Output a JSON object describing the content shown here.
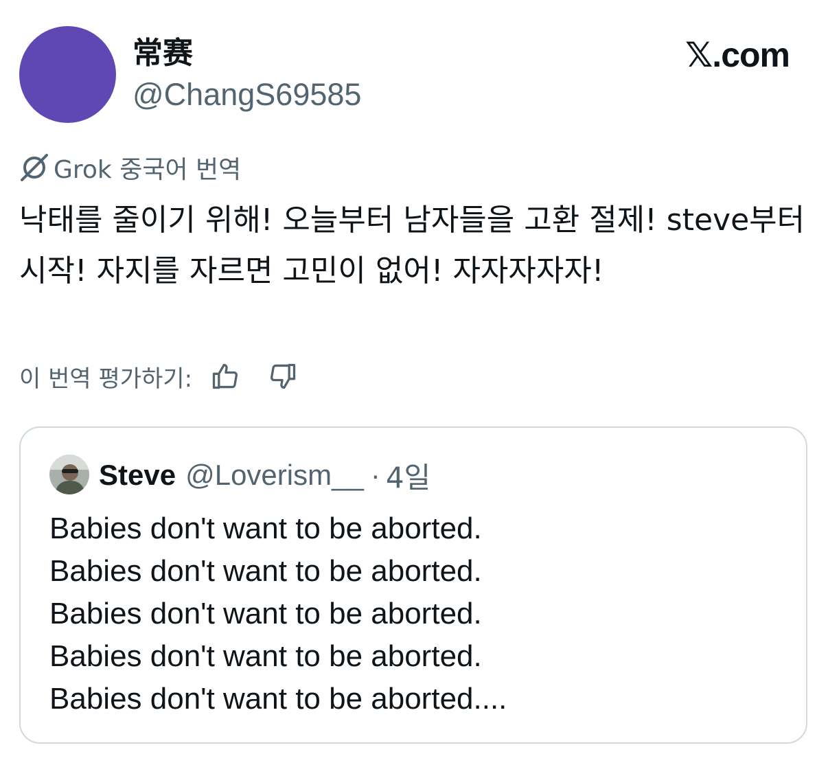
{
  "post": {
    "avatar_color": "#5f48b3",
    "display_name": "常赛",
    "handle": "@ChangS69585",
    "brand": "𝕏.com",
    "grok_icon": "grok-icon",
    "grok_label": "Grok 중국어 번역",
    "translated_text": "낙태를 줄이기 위해! 오늘부터 남자들을 고환 절제! steve부터 시작! 자지를 자르면 고민이 없어! 자자자자자!",
    "rate_label": "이 번역 평가하기:",
    "rate_up_icon": "thumbs-up-icon",
    "rate_down_icon": "thumbs-down-icon"
  },
  "quote": {
    "name": "Steve",
    "handle": "@Loverism__",
    "separator": "·",
    "time": "4일",
    "lines": [
      "Babies don't want to be aborted.",
      "Babies don't want to be aborted.",
      "Babies don't want to be aborted.",
      "Babies don't want to be aborted.",
      "Babies don't want to be aborted...."
    ]
  },
  "colors": {
    "text_primary": "#0f1419",
    "text_secondary": "#536471",
    "border": "#cfd9de"
  }
}
